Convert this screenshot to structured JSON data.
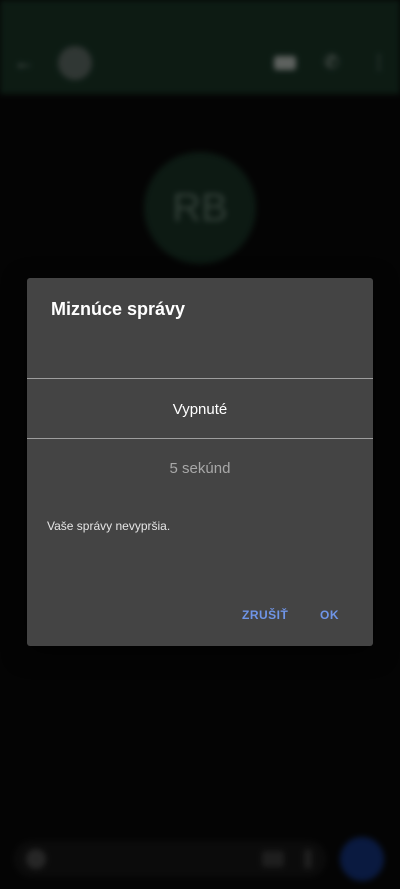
{
  "dialog": {
    "title": "Miznúce správy",
    "options": [
      {
        "label": "Vypnuté",
        "selected": true
      },
      {
        "label": "5 sekúnd",
        "selected": false
      }
    ],
    "description": "Vaše správy nevypršia.",
    "cancel_label": "ZRUŠIŤ",
    "ok_label": "OK"
  },
  "colors": {
    "dialog_bg": "#444444",
    "accent": "#6f95e8",
    "app_bar": "#1d3d2c",
    "send_button": "#173a8e"
  },
  "background": {
    "avatar_initials": "RB"
  }
}
